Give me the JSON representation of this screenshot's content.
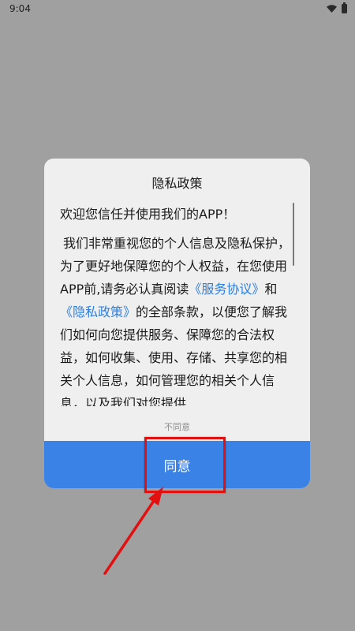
{
  "status_bar": {
    "time": "9:04"
  },
  "dialog": {
    "title": "隐私政策",
    "welcome": "欢迎您信任并使用我们的APP！",
    "para_part1": "我们非常重视您的个人信息及隐私保护，为了更好地保障您的个人权益，在您使用APP前,请务必认真阅读",
    "service_link": "《服务协议》",
    "para_and": "和",
    "privacy_link": "《隐私政策》",
    "para_part2": "的全部条款，以便您了解我们如何向您提供服务、保障您的合法权益，如何收集、使用、存储、共享您的相关个人信息，如何管理您的相关个人信息，以及我们对您提供",
    "disagree_label": "不同意",
    "agree_label": "同意"
  },
  "colors": {
    "overlay": "#a0a0a0",
    "dialog_bg": "#efefef",
    "link": "#2c7fe0",
    "agree_bg": "#3a82e6",
    "highlight": "#e21010"
  },
  "icons": [
    "wifi-icon",
    "battery-icon",
    "arrow-icon"
  ]
}
